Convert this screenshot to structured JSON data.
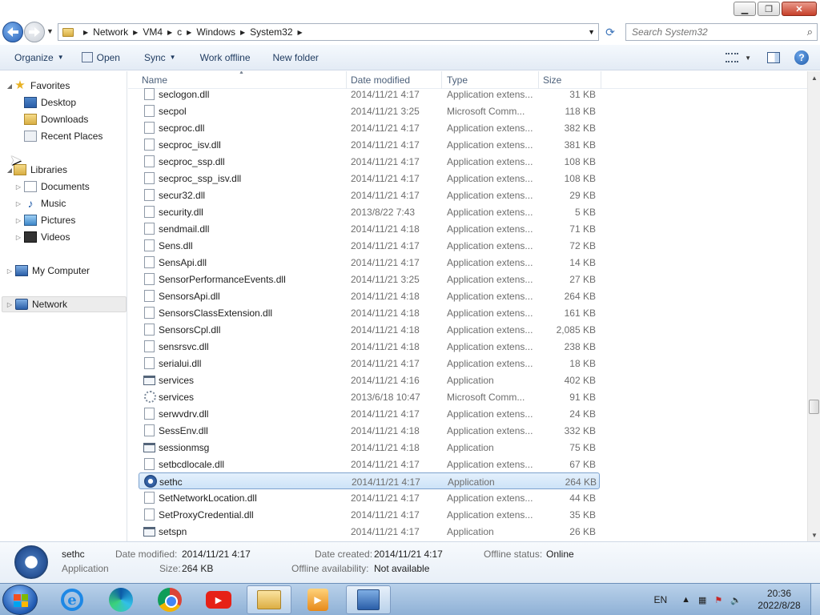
{
  "window": {
    "minimize": "▁",
    "maximize": "❐",
    "close": "✕"
  },
  "address": {
    "crumbs": [
      "Network",
      "VM4",
      "c",
      "Windows",
      "System32"
    ],
    "search_placeholder": "Search System32"
  },
  "toolbar": {
    "organize": "Organize",
    "open": "Open",
    "sync": "Sync",
    "work_offline": "Work offline",
    "new_folder": "New folder"
  },
  "nav": {
    "favorites": "Favorites",
    "desktop": "Desktop",
    "downloads": "Downloads",
    "recent_places": "Recent Places",
    "libraries": "Libraries",
    "documents": "Documents",
    "music": "Music",
    "pictures": "Pictures",
    "videos": "Videos",
    "my_computer": "My Computer",
    "network": "Network"
  },
  "columns": {
    "name": "Name",
    "date": "Date modified",
    "type": "Type",
    "size": "Size"
  },
  "files": [
    {
      "name": "seclogon.dll",
      "date": "2014/11/21 4:17",
      "type": "Application extens...",
      "size": "31 KB",
      "icon": "dll"
    },
    {
      "name": "secpol",
      "date": "2014/11/21 3:25",
      "type": "Microsoft Comm...",
      "size": "118 KB",
      "icon": "dll"
    },
    {
      "name": "secproc.dll",
      "date": "2014/11/21 4:17",
      "type": "Application extens...",
      "size": "382 KB",
      "icon": "dll"
    },
    {
      "name": "secproc_isv.dll",
      "date": "2014/11/21 4:17",
      "type": "Application extens...",
      "size": "381 KB",
      "icon": "dll"
    },
    {
      "name": "secproc_ssp.dll",
      "date": "2014/11/21 4:17",
      "type": "Application extens...",
      "size": "108 KB",
      "icon": "dll"
    },
    {
      "name": "secproc_ssp_isv.dll",
      "date": "2014/11/21 4:17",
      "type": "Application extens...",
      "size": "108 KB",
      "icon": "dll"
    },
    {
      "name": "secur32.dll",
      "date": "2014/11/21 4:17",
      "type": "Application extens...",
      "size": "29 KB",
      "icon": "dll"
    },
    {
      "name": "security.dll",
      "date": "2013/8/22 7:43",
      "type": "Application extens...",
      "size": "5 KB",
      "icon": "dll"
    },
    {
      "name": "sendmail.dll",
      "date": "2014/11/21 4:18",
      "type": "Application extens...",
      "size": "71 KB",
      "icon": "dll"
    },
    {
      "name": "Sens.dll",
      "date": "2014/11/21 4:17",
      "type": "Application extens...",
      "size": "72 KB",
      "icon": "dll"
    },
    {
      "name": "SensApi.dll",
      "date": "2014/11/21 4:17",
      "type": "Application extens...",
      "size": "14 KB",
      "icon": "dll"
    },
    {
      "name": "SensorPerformanceEvents.dll",
      "date": "2014/11/21 3:25",
      "type": "Application extens...",
      "size": "27 KB",
      "icon": "dll"
    },
    {
      "name": "SensorsApi.dll",
      "date": "2014/11/21 4:18",
      "type": "Application extens...",
      "size": "264 KB",
      "icon": "dll"
    },
    {
      "name": "SensorsClassExtension.dll",
      "date": "2014/11/21 4:18",
      "type": "Application extens...",
      "size": "161 KB",
      "icon": "dll"
    },
    {
      "name": "SensorsCpl.dll",
      "date": "2014/11/21 4:18",
      "type": "Application extens...",
      "size": "2,085 KB",
      "icon": "dll"
    },
    {
      "name": "sensrsvc.dll",
      "date": "2014/11/21 4:18",
      "type": "Application extens...",
      "size": "238 KB",
      "icon": "dll"
    },
    {
      "name": "serialui.dll",
      "date": "2014/11/21 4:17",
      "type": "Application extens...",
      "size": "18 KB",
      "icon": "dll"
    },
    {
      "name": "services",
      "date": "2014/11/21 4:16",
      "type": "Application",
      "size": "402 KB",
      "icon": "app"
    },
    {
      "name": "services",
      "date": "2013/6/18 10:47",
      "type": "Microsoft Comm...",
      "size": "91 KB",
      "icon": "msc"
    },
    {
      "name": "serwvdrv.dll",
      "date": "2014/11/21 4:17",
      "type": "Application extens...",
      "size": "24 KB",
      "icon": "dll"
    },
    {
      "name": "SessEnv.dll",
      "date": "2014/11/21 4:18",
      "type": "Application extens...",
      "size": "332 KB",
      "icon": "dll"
    },
    {
      "name": "sessionmsg",
      "date": "2014/11/21 4:18",
      "type": "Application",
      "size": "75 KB",
      "icon": "app"
    },
    {
      "name": "setbcdlocale.dll",
      "date": "2014/11/21 4:17",
      "type": "Application extens...",
      "size": "67 KB",
      "icon": "dll"
    },
    {
      "name": "sethc",
      "date": "2014/11/21 4:17",
      "type": "Application",
      "size": "264 KB",
      "icon": "sethc",
      "selected": true
    },
    {
      "name": "SetNetworkLocation.dll",
      "date": "2014/11/21 4:17",
      "type": "Application extens...",
      "size": "44 KB",
      "icon": "dll"
    },
    {
      "name": "SetProxyCredential.dll",
      "date": "2014/11/21 4:17",
      "type": "Application extens...",
      "size": "35 KB",
      "icon": "dll"
    },
    {
      "name": "setspn",
      "date": "2014/11/21 4:17",
      "type": "Application",
      "size": "26 KB",
      "icon": "app"
    }
  ],
  "details": {
    "name": "sethc",
    "type": "Application",
    "date_modified_label": "Date modified:",
    "date_modified": "2014/11/21 4:17",
    "size_label": "Size:",
    "size": "264 KB",
    "date_created_label": "Date created:",
    "date_created": "2014/11/21 4:17",
    "offline_avail_label": "Offline availability:",
    "offline_avail": "Not available",
    "offline_status_label": "Offline status:",
    "offline_status": "Online"
  },
  "taskbar": {
    "lang": "EN",
    "time": "20:36",
    "date": "2022/8/28"
  }
}
